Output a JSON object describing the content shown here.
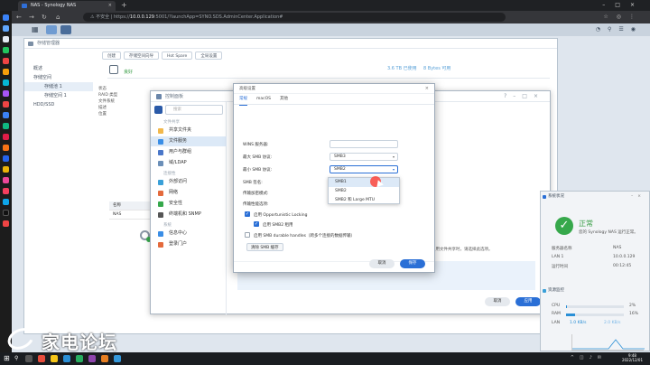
{
  "browser": {
    "tab_title": "NAS - Synology NAS",
    "address": "10.0.0.129",
    "address_rest": ":5001/?launchApp=SYNO.SDS.AdminCenter.Application#",
    "insecure_label": "不安全"
  },
  "dsm": {
    "storage_manager": {
      "title": "存储管理器",
      "nav": [
        "概述",
        "存储空间",
        "存储池 1",
        "存储空间 1",
        "HDD/SSD"
      ],
      "toolbar": [
        "创建",
        "存储空间向导",
        "Hot Spare",
        "全局设置"
      ],
      "volume_status": "良好",
      "capacity_used": "3.6 TB 已使用",
      "capacity_free": "8 Bytes 可用",
      "info_lines": [
        "状态",
        "RAID 类型",
        "文件系统",
        "描述",
        "位置"
      ],
      "table_header": "名称",
      "table_row": "NAS"
    },
    "control_panel": {
      "title": "控制面板",
      "search_placeholder": "搜索",
      "groups": [
        "文件共享",
        "连接性",
        "系统"
      ],
      "items": [
        "共享文件夹",
        "文件服务",
        "用户与群组",
        "域/LDAP",
        "外部访问",
        "网络",
        "安全性",
        "终端机和 SNMP",
        "信息中心",
        "登录门户"
      ],
      "selected_item": "文件服务",
      "right_note": "在 Mac 上启用文件共享时，请选择此选项。",
      "cancel_label": "取消",
      "apply_label": "应用"
    },
    "dialog": {
      "title": "高级设置",
      "close": "×",
      "tabs": [
        "常规",
        "macOS",
        "其他"
      ],
      "active_tab": "常规",
      "rows": {
        "wins_label": "WINS 服务器:",
        "max_label": "最大 SMB 协议:",
        "max_value": "SMB3",
        "min_label": "最小 SMB 协议:",
        "min_value": "SMB2",
        "smb_signing_label": "SMB 签名:",
        "transport_label": "传输加密模式:",
        "perf_label": "传输性能选项:",
        "oplock_label": "启用 Opportunistic Locking",
        "smb2_lease_label": "启用 SMB2 租用",
        "durable_label": "启用 SMB durable handles（跨多个连接的数据传输）",
        "smb_clear_label": "清除 SMB 缓存"
      },
      "cancel_label": "取消",
      "save_label": "保存"
    },
    "dropdown": {
      "options": [
        "SMB1",
        "SMB2",
        "SMB2 和 Large MTU"
      ],
      "highlighted": "SMB1"
    },
    "resource_monitor": {
      "health_title": "系统状况",
      "status": "正常",
      "subtitle": "您的 Synology NAS 运行正常。",
      "kv": [
        {
          "k": "服务器名称",
          "v": "NAS"
        },
        {
          "k": "LAN 1",
          "v": "10.0.0.129"
        },
        {
          "k": "运行时间",
          "v": "00:12:45"
        }
      ],
      "monitor_title": "资源监控",
      "cpu_label": "CPU",
      "cpu_value": "2%",
      "cpu_fraction": 0.02,
      "ram_label": "RAM",
      "ram_value": "16%",
      "ram_fraction": 0.16,
      "lan_label": "LAN",
      "upload": "1.0 KB/s",
      "download": "2.0 KB/s",
      "graph_ticks": [
        "5000",
        "4000",
        "3000",
        "2000",
        "1000",
        "0"
      ]
    }
  },
  "taskbar": {
    "time": "9:48",
    "date": "2022/12/01"
  },
  "watermark": {
    "text": "家电论坛"
  },
  "colors": {
    "accent": "#2a6fd6",
    "success": "#36a84b",
    "dock_bg": "#1c1c1c"
  }
}
